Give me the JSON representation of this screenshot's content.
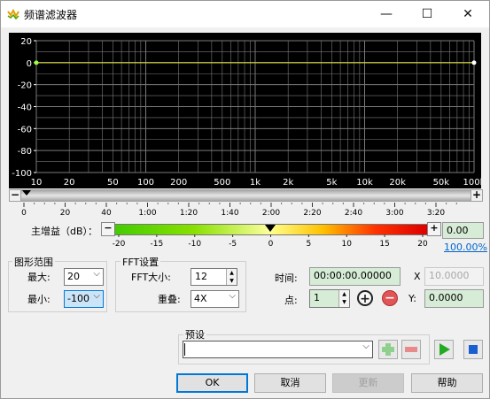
{
  "window": {
    "title": "频谱滤波器",
    "minimize_glyph": "—",
    "maximize_glyph": "☐",
    "close_glyph": "✕"
  },
  "plot": {
    "y_ticks": [
      "20",
      "0",
      "-20",
      "-40",
      "-60",
      "-80",
      "-100"
    ],
    "x_ticks": [
      "10",
      "20",
      "50",
      "100",
      "200",
      "500",
      "1k",
      "2k",
      "5k",
      "10k",
      "20k",
      "50k",
      "100k"
    ],
    "line_color": "#e0e040",
    "grid_color": "#7a7a7a"
  },
  "scrollbar": {
    "left_glyph": "−",
    "right_glyph": "+"
  },
  "time_ruler": {
    "labels": [
      "0",
      "20",
      "40",
      "1:00",
      "1:20",
      "1:40",
      "2:00",
      "2:20",
      "2:40",
      "3:00",
      "3:20"
    ]
  },
  "gain": {
    "label": "主增益（dB）：",
    "minus_glyph": "−",
    "plus_glyph": "+",
    "scale": [
      "-20",
      "-15",
      "-10",
      "-5",
      "0",
      "5",
      "10",
      "15",
      "20"
    ],
    "value": "0.00",
    "percent_link": "100.00%",
    "gradient_left": [
      "#44cc00",
      "#88e000",
      "#ffffa0"
    ],
    "gradient_right": [
      "#ffff88",
      "#ffc000",
      "#ff3300",
      "#dd0000"
    ]
  },
  "graph_range": {
    "title": "图形范围",
    "max_label": "最大:",
    "max_value": "20",
    "min_label": "最小:",
    "min_value": "-100"
  },
  "fft": {
    "title": "FFT设置",
    "size_label": "FFT大小:",
    "size_value": "12",
    "overlap_label": "重叠:",
    "overlap_value": "4X"
  },
  "position": {
    "time_label": "时间:",
    "time_value": "00:00:00.00000",
    "x_label": "X",
    "x_value": "10.0000",
    "point_label": "点:",
    "point_value": "1",
    "y_label": "Y:",
    "y_value": "0.0000"
  },
  "preset": {
    "title": "预设",
    "value": ""
  },
  "buttons": {
    "ok": "OK",
    "cancel": "取消",
    "update": "更新",
    "help": "帮助"
  }
}
